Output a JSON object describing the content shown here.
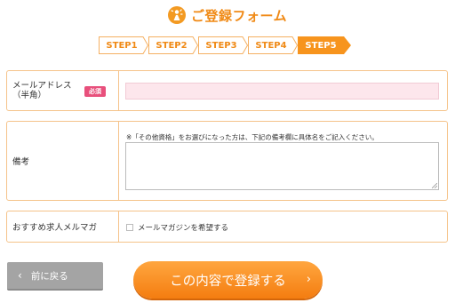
{
  "header": {
    "title": "ご登録フォーム",
    "logo_icon": "person-sparkle-icon"
  },
  "steps": {
    "items": [
      "STEP1",
      "STEP2",
      "STEP3",
      "STEP4",
      "STEP5"
    ],
    "active_index": 4,
    "active_color": "#f7941d",
    "inactive_fill": "#ffffff",
    "border_color": "#f5b062"
  },
  "form": {
    "email": {
      "label": "メールアドレス\n（半角）",
      "required_badge": "必須",
      "value": ""
    },
    "remarks": {
      "label": "備考",
      "note": "※「その他資格」をお選びになった方は、下記の備考欄に具体名をご記入ください。",
      "value": ""
    },
    "mailmag": {
      "label": "おすすめ求人メルマガ",
      "checkbox_label": "メールマガジンを希望する",
      "checked": false
    }
  },
  "buttons": {
    "back_label": "前に戻る",
    "submit_label": "この内容で登録する"
  },
  "colors": {
    "accent": "#f08a16",
    "required": "#e8507c",
    "email_bg": "#fde6ec"
  }
}
